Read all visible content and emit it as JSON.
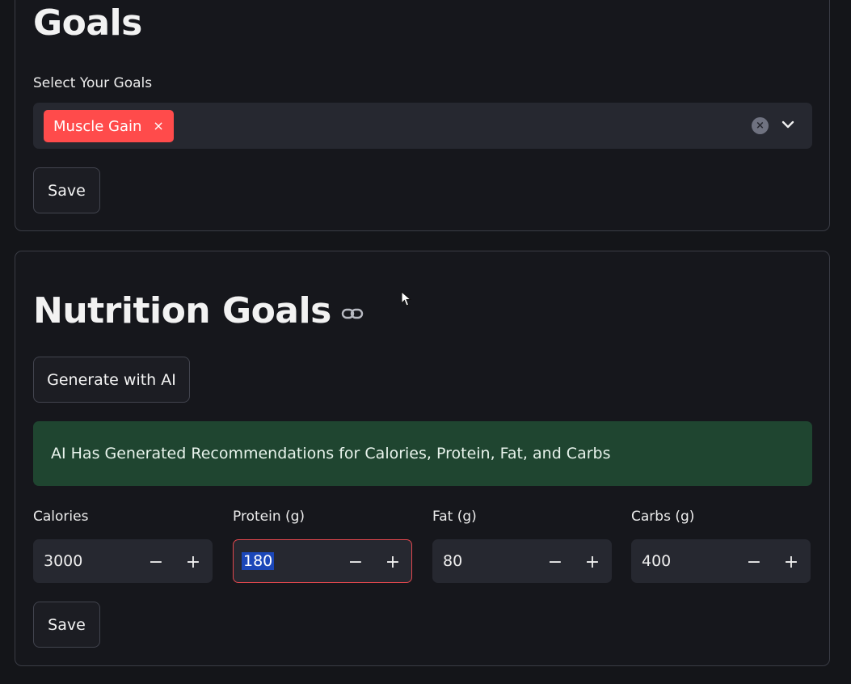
{
  "goals_section": {
    "title": "Goals",
    "select_label": "Select Your Goals",
    "selected_tags": [
      "Muscle Gain"
    ],
    "tag_color": "#ff4b4b",
    "save_label": "Save"
  },
  "nutrition_section": {
    "title": "Nutrition Goals",
    "generate_label": "Generate with AI",
    "alert_text": "AI Has Generated Recommendations for Calories, Protein, Fat, and Carbs",
    "alert_color": "#1f4530",
    "fields": [
      {
        "label": "Calories",
        "value": "3000"
      },
      {
        "label": "Protein (g)",
        "value": "180"
      },
      {
        "label": "Fat (g)",
        "value": "80"
      },
      {
        "label": "Carbs (g)",
        "value": "400"
      }
    ],
    "minus_symbol": "−",
    "plus_symbol": "+",
    "save_label": "Save"
  },
  "icons": {
    "tag_remove": "×",
    "clear": "×",
    "chevron": "chevron-down-icon",
    "link": "link-icon"
  }
}
